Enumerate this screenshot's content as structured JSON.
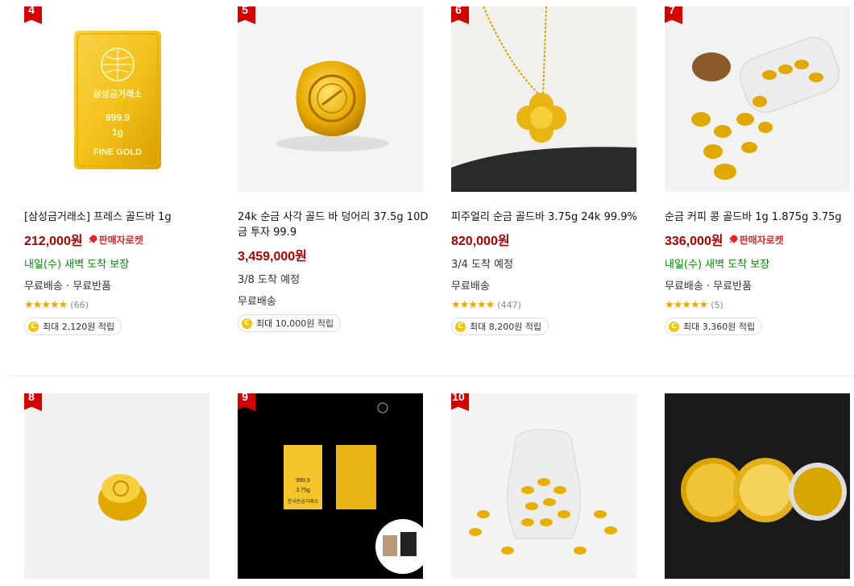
{
  "products": [
    {
      "rank": "4",
      "title": "[삼성금거래소] 프레스 골드바 1g",
      "price": "212,000원",
      "badge": "판매자로켓",
      "delivery": "내일(수) 새벽 도착 보장",
      "shipping": "무료배송 · 무료반품",
      "rating_count": "(66)",
      "reward": "최대 2,120원 적립",
      "bar_text": [
        "삼성금거래소",
        "999.9",
        "1g",
        "FINE GOLD"
      ]
    },
    {
      "rank": "5",
      "title": "24k 순금 사각 골드 바 덩어리 37.5g 10D 금 투자 99.9",
      "price": "3,459,000원",
      "delivery": "3/8 도착 예정",
      "shipping": "무료배송",
      "reward": "최대 10,000원 적립"
    },
    {
      "rank": "6",
      "title": "피주얼리 순금 골드바 3.75g 24k 99.9%",
      "price": "820,000원",
      "delivery": "3/4 도착 예정",
      "shipping": "무료배송",
      "rating_count": "(447)",
      "reward": "최대 8,200원 적립"
    },
    {
      "rank": "7",
      "title": "순금 커피 콩 골드바 1g 1.875g 3.75g",
      "price": "336,000원",
      "badge": "판매자로켓",
      "delivery": "내일(수) 새벽 도착 보장",
      "shipping": "무료배송 · 무료반품",
      "rating_count": "(5)",
      "reward": "최대 3,360원 적립"
    },
    {
      "rank": "8"
    },
    {
      "rank": "9",
      "bar_text": [
        "999.9",
        "3.75g",
        "한국순금거래소"
      ]
    },
    {
      "rank": "10"
    },
    {
      "rank": ""
    }
  ],
  "stars": "★★★★★",
  "coin_symbol": "C"
}
